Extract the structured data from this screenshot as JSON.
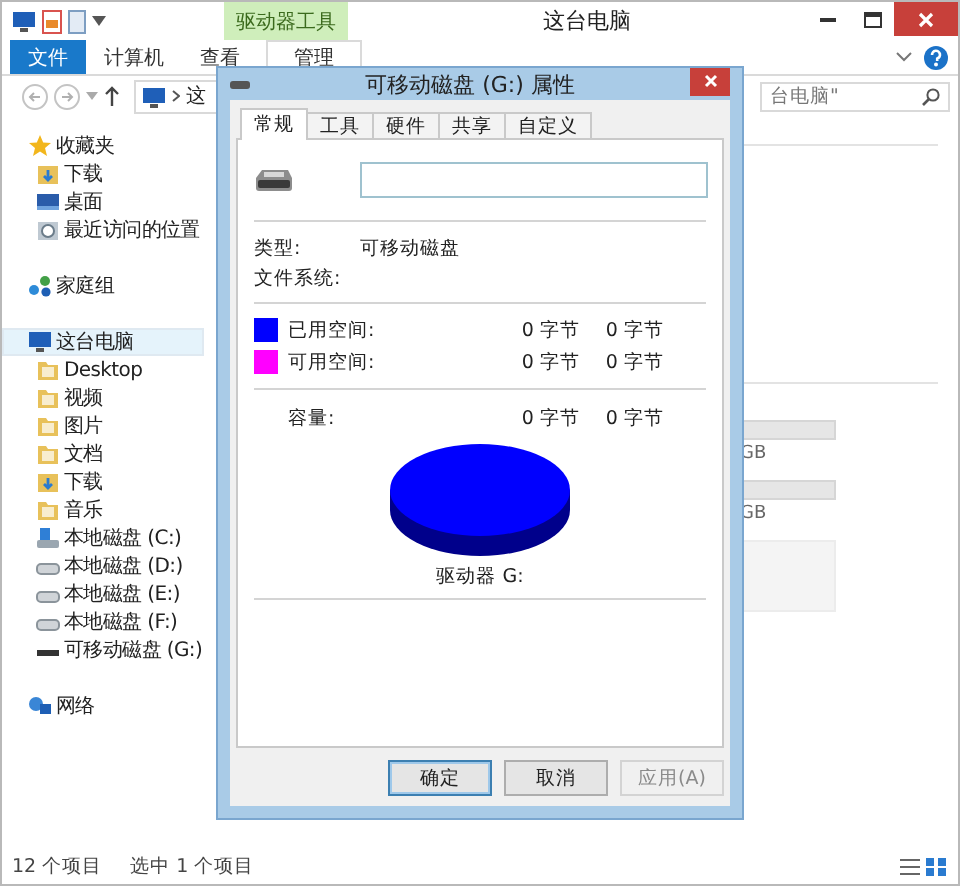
{
  "window": {
    "title": "这台电脑",
    "contextual_group": "驱动器工具"
  },
  "ribbon_tabs": [
    {
      "label": "文件",
      "kind": "file"
    },
    {
      "label": "计算机",
      "kind": "normal"
    },
    {
      "label": "查看",
      "kind": "normal"
    },
    {
      "label": "管理",
      "kind": "contextual"
    }
  ],
  "address_bar": {
    "path": "这"
  },
  "search": {
    "placeholder": "台电脑\""
  },
  "sidebar": {
    "items": [
      {
        "label": "收藏夹",
        "kind": "favorites",
        "selected": false,
        "children": [
          {
            "label": "下载",
            "kind": "downloads",
            "selected": false
          },
          {
            "label": "桌面",
            "kind": "desktop",
            "selected": false
          },
          {
            "label": "最近访问的位置",
            "kind": "recent",
            "selected": false
          }
        ]
      },
      {
        "label": "家庭组",
        "kind": "homegroup",
        "selected": false
      },
      {
        "label": "这台电脑",
        "kind": "computer",
        "selected": true,
        "children": [
          {
            "label": "Desktop",
            "kind": "folder",
            "selected": false
          },
          {
            "label": "视频",
            "kind": "folder",
            "selected": false
          },
          {
            "label": "图片",
            "kind": "folder",
            "selected": false
          },
          {
            "label": "文档",
            "kind": "folder",
            "selected": false
          },
          {
            "label": "下载",
            "kind": "downloads",
            "selected": false
          },
          {
            "label": "音乐",
            "kind": "folder",
            "selected": false
          },
          {
            "label": "本地磁盘 (C:)",
            "kind": "systemdrive",
            "selected": false
          },
          {
            "label": "本地磁盘 (D:)",
            "kind": "drive",
            "selected": false
          },
          {
            "label": "本地磁盘 (E:)",
            "kind": "drive",
            "selected": false
          },
          {
            "label": "本地磁盘 (F:)",
            "kind": "drive",
            "selected": false
          },
          {
            "label": "可移动磁盘 (G:)",
            "kind": "removable",
            "selected": false
          }
        ]
      },
      {
        "label": "网络",
        "kind": "network",
        "selected": false
      }
    ]
  },
  "drives_pane": {
    "drives": [
      {
        "level": 0,
        "size": "GB"
      },
      {
        "level": 0,
        "size": "GB"
      }
    ]
  },
  "status_bar": {
    "item_count": "12 个项目",
    "selection": "选中 1 个项目"
  },
  "dialog": {
    "title": "可移动磁盘 (G:) 属性",
    "tabs": [
      {
        "label": "常规",
        "selected": true
      },
      {
        "label": "工具",
        "selected": false
      },
      {
        "label": "硬件",
        "selected": false
      },
      {
        "label": "共享",
        "selected": false
      },
      {
        "label": "自定义",
        "selected": false
      }
    ],
    "properties": [
      {
        "label": "类型:",
        "value": "可移动磁盘"
      },
      {
        "label": "文件系统:"
      }
    ],
    "space": [
      {
        "label": "已用空间:",
        "color": "#0000ff",
        "bytes": "0 字节",
        "size": "0 字节"
      },
      {
        "label": "可用空间:",
        "color": "#ff00ff",
        "bytes": "0 字节",
        "size": "0 字节"
      }
    ],
    "capacity": {
      "label": "容量:",
      "bytes": "0 字节",
      "size": "0 字节"
    },
    "drive_label": "驱动器 G:",
    "buttons": [
      {
        "label": "确定",
        "kind": "default",
        "disabled": false
      },
      {
        "label": "取消",
        "kind": "normal",
        "disabled": false
      },
      {
        "label": "应用(A)",
        "kind": "normal",
        "disabled": true
      }
    ]
  }
}
